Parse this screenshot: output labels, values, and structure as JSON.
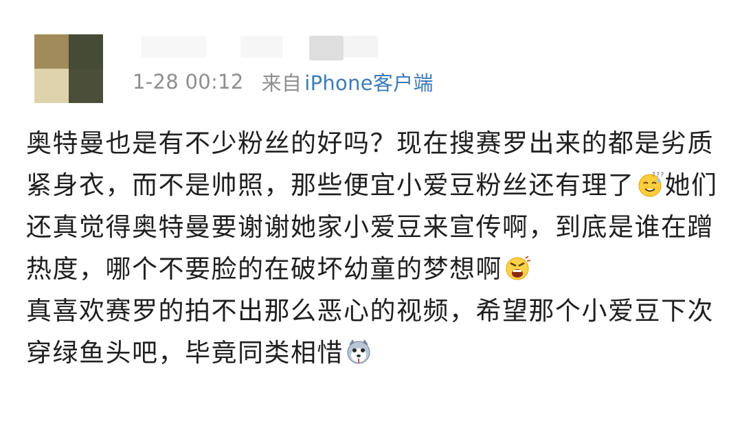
{
  "post": {
    "meta": {
      "time": "1-28 00:12",
      "from_label": "来自",
      "source": "iPhone客户端"
    },
    "paragraphs": [
      {
        "segments": [
          {
            "type": "text",
            "value": "奥特曼也是有不少粉丝的好吗？现在搜赛罗出来的都是劣质紧身衣，而不是帅照，那些便宜小爱豆粉丝还有理了"
          },
          {
            "type": "emoji",
            "name": "thinking-sweat-face-emoji"
          },
          {
            "type": "text",
            "value": "她们还真觉得奥特曼要谢谢她家小爱豆来宣传啊，到底是谁在蹭热度，哪个不要脸的在破坏幼童的梦想啊"
          },
          {
            "type": "emoji",
            "name": "angry-shout-face-emoji"
          }
        ]
      },
      {
        "segments": [
          {
            "type": "text",
            "value": "真喜欢赛罗的拍不出那么恶心的视频，希望那个小爱豆下次穿绿鱼头吧，毕竟同类相惜"
          },
          {
            "type": "emoji",
            "name": "husky-dog-face-emoji"
          }
        ]
      }
    ]
  },
  "colors": {
    "meta_text": "#8e8e8e",
    "source_link": "#3e7bb8",
    "body_text": "#1f1f1f"
  }
}
